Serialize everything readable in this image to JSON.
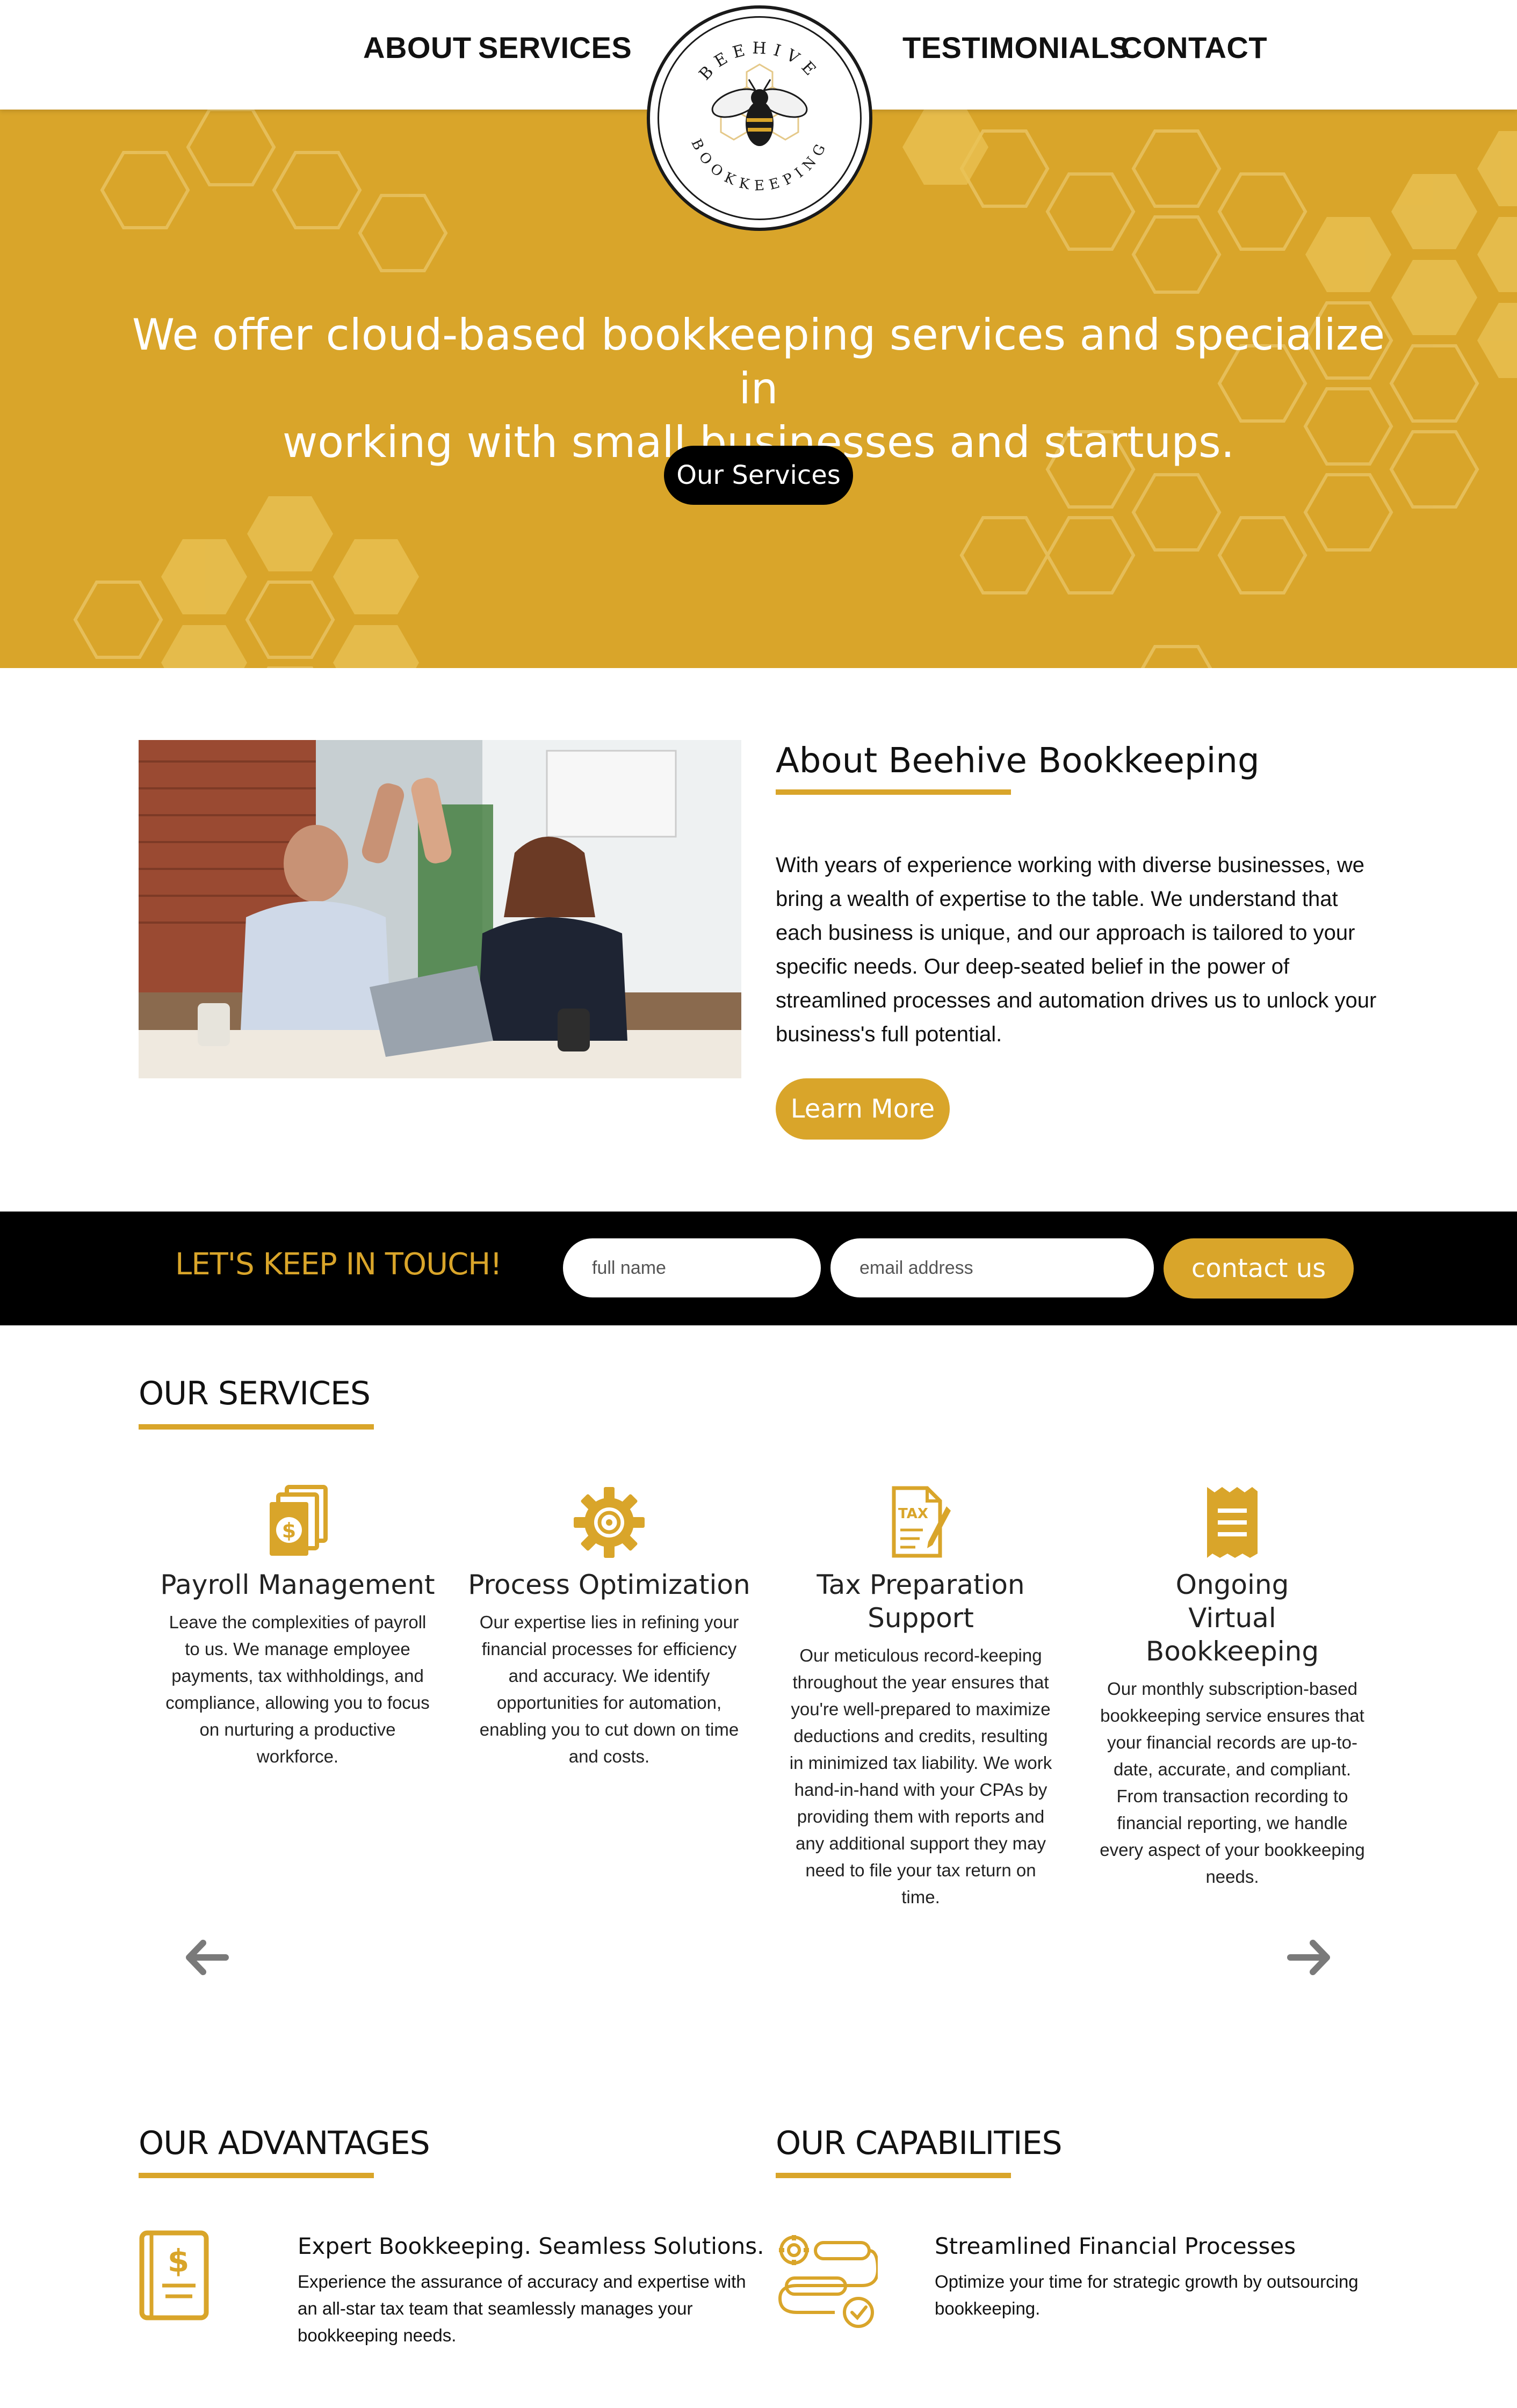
{
  "nav": {
    "about": "ABOUT",
    "services": "SERVICES",
    "testimonials": "TESTIMONIALS",
    "contact": "CONTACT"
  },
  "logo": {
    "top_text": "BEEHIVE",
    "bottom_text": "BOOKKEEPING"
  },
  "hero": {
    "line1": "We offer cloud-based bookkeeping services and specialize in",
    "line2": "working with small businesses and startups.",
    "button": "Our Services"
  },
  "about": {
    "title": "About Beehive Bookkeeping",
    "body": "With years of experience working with diverse businesses, we bring a wealth of expertise to the table. We understand that each business is unique, and our approach is tailored to your specific needs. Our deep-seated belief in the power of streamlined processes and automation drives us to unlock your business's full potential.",
    "button": "Learn More"
  },
  "cta": {
    "title": "LET'S KEEP IN TOUCH!",
    "name_placeholder": "full name",
    "email_placeholder": "email address",
    "button": "contact us"
  },
  "services": {
    "title": "OUR SERVICES",
    "items": [
      {
        "icon": "payroll-money-icon",
        "title": "Payroll Management",
        "desc": "Leave the complexities of payroll to us. We manage employee payments, tax withholdings, and compliance, allowing you to focus on nurturing a productive workforce."
      },
      {
        "icon": "gear-icon",
        "title": "Process Optimization",
        "desc": "Our expertise lies in refining your financial processes for efficiency and accuracy. We identify opportunities for automation, enabling you to cut down on time and costs."
      },
      {
        "icon": "tax-document-icon",
        "title": "Tax Preparation Support",
        "desc": "Our meticulous record-keeping throughout the year ensures that you're well-prepared to maximize deductions and credits, resulting in minimized tax liability. We work hand-in-hand with your CPAs by providing them with reports and any additional support they may need to file your tax return on time."
      },
      {
        "icon": "receipt-icon",
        "title": "Ongoing Virtual Bookkeeping",
        "desc": "Our monthly subscription-based bookkeeping service ensures that your financial records are up-to-date, accurate, and compliant. From transaction recording to financial reporting, we handle every aspect of your bookkeeping needs."
      }
    ]
  },
  "advantages": {
    "title": "OUR ADVANTAGES",
    "item_title": "Expert Bookkeeping. Seamless Solutions.",
    "item_body": "Experience the assurance of accuracy and expertise with an all-star tax team that seamlessly manages your bookkeeping needs."
  },
  "capabilities": {
    "title": "OUR CAPABILITIES",
    "item_title": "Streamlined Financial Processes",
    "item_body": "Optimize your time for strategic growth by outsourcing bookkeeping."
  },
  "colors": {
    "accent": "#d9a52a",
    "dark": "#000000",
    "text": "#111111"
  }
}
